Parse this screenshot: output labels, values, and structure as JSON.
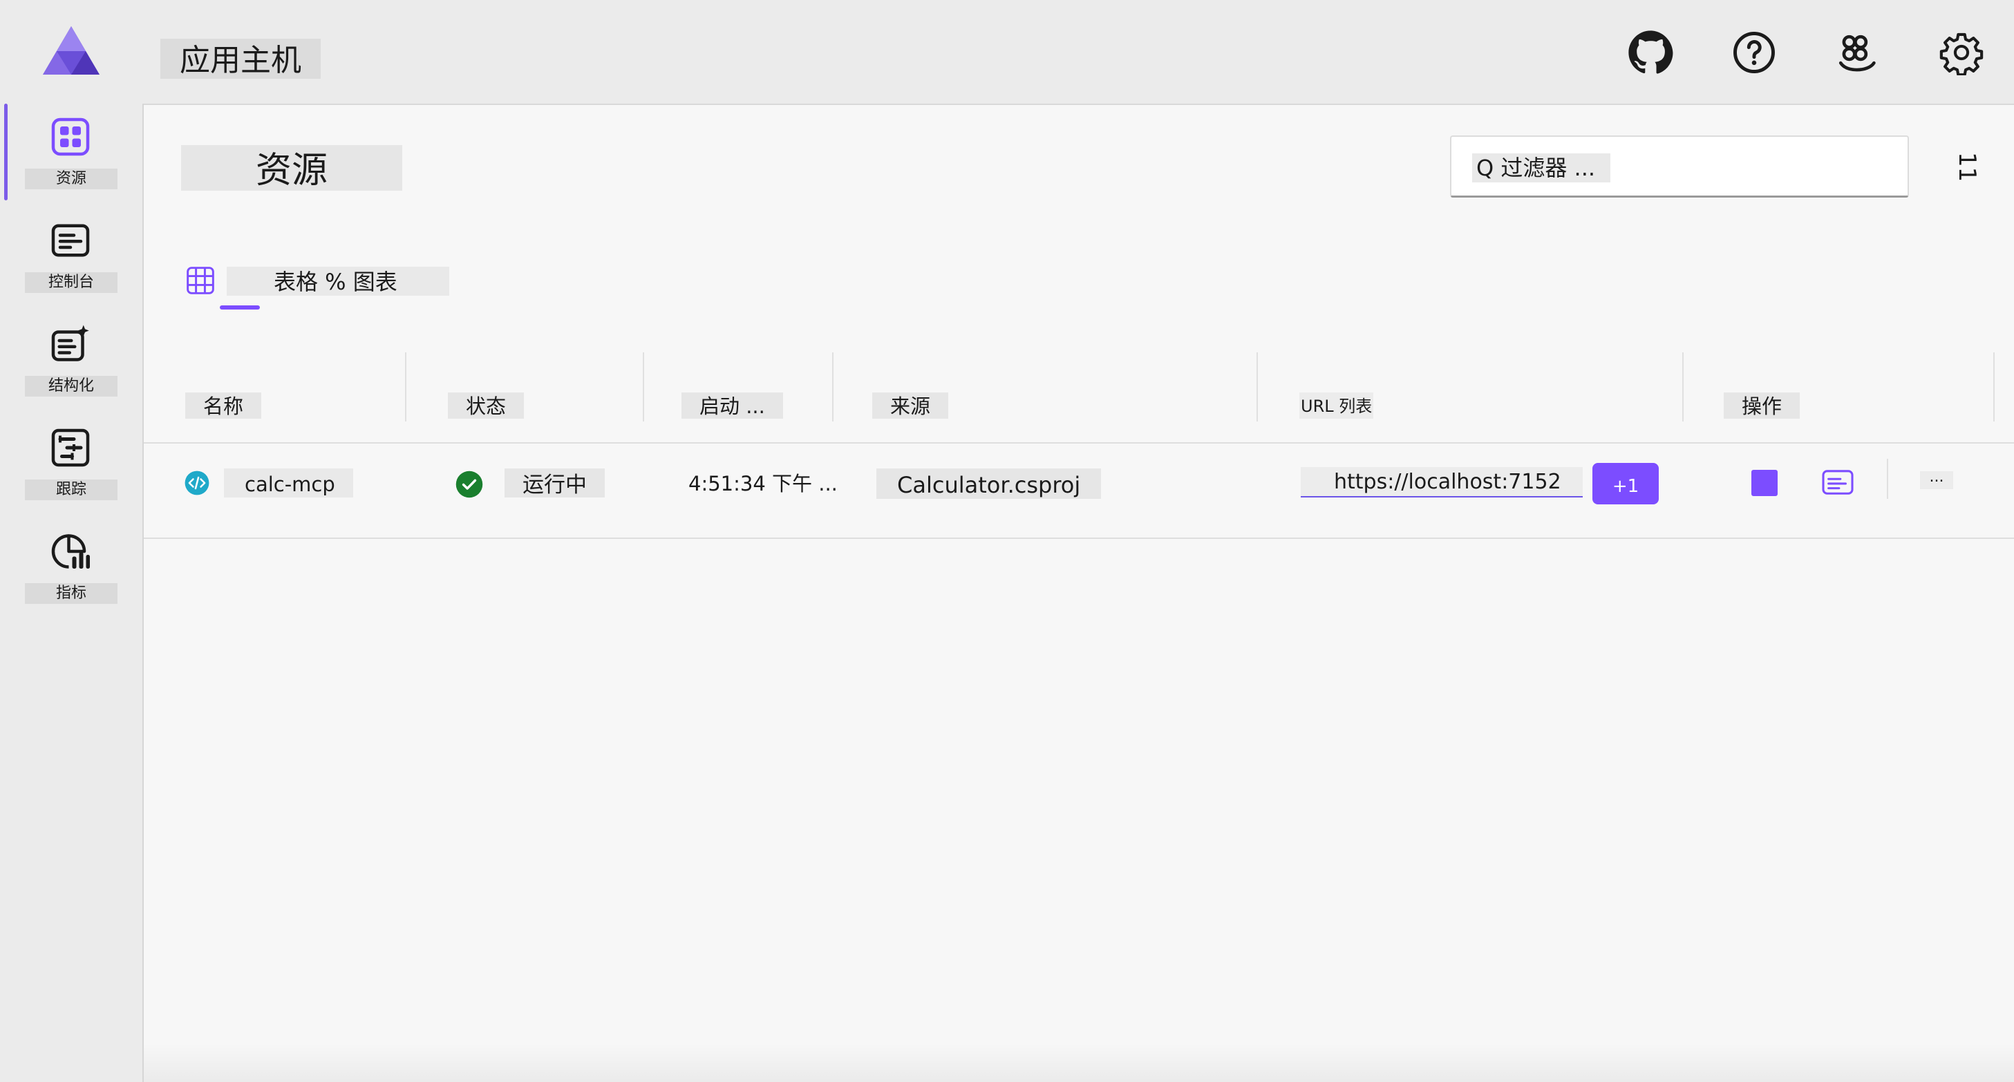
{
  "header": {
    "app_title": "应用主机",
    "icons": [
      "github-icon",
      "help-icon",
      "people-icon",
      "settings-icon"
    ]
  },
  "sidebar": {
    "items": [
      {
        "label": "资源",
        "icon": "grid-icon",
        "active": true
      },
      {
        "label": "控制台",
        "icon": "console-icon",
        "active": false
      },
      {
        "label": "结构化",
        "icon": "structured-logs-icon",
        "active": false
      },
      {
        "label": "跟踪",
        "icon": "traces-icon",
        "active": false
      },
      {
        "label": "指标",
        "icon": "metrics-icon",
        "active": false
      }
    ]
  },
  "main": {
    "page_title": "资源",
    "filter_placeholder": "Q 过滤器 ...",
    "panel_toggle": "11",
    "tab_label": "表格 % 图表",
    "columns": [
      "名称",
      "状态",
      "启动 ...",
      "来源",
      "URL 列表",
      "操作"
    ],
    "rows": [
      {
        "name": "calc-mcp",
        "status": "运行中",
        "started": "4:51:34 下午 ...",
        "source": "Calculator.csproj",
        "url": "https://localhost:7152",
        "more_urls": "+1",
        "more_actions": "..."
      }
    ]
  },
  "colors": {
    "accent": "#7c4dff",
    "running": "#1a7f2e",
    "project_icon": "#1fa9c9"
  }
}
